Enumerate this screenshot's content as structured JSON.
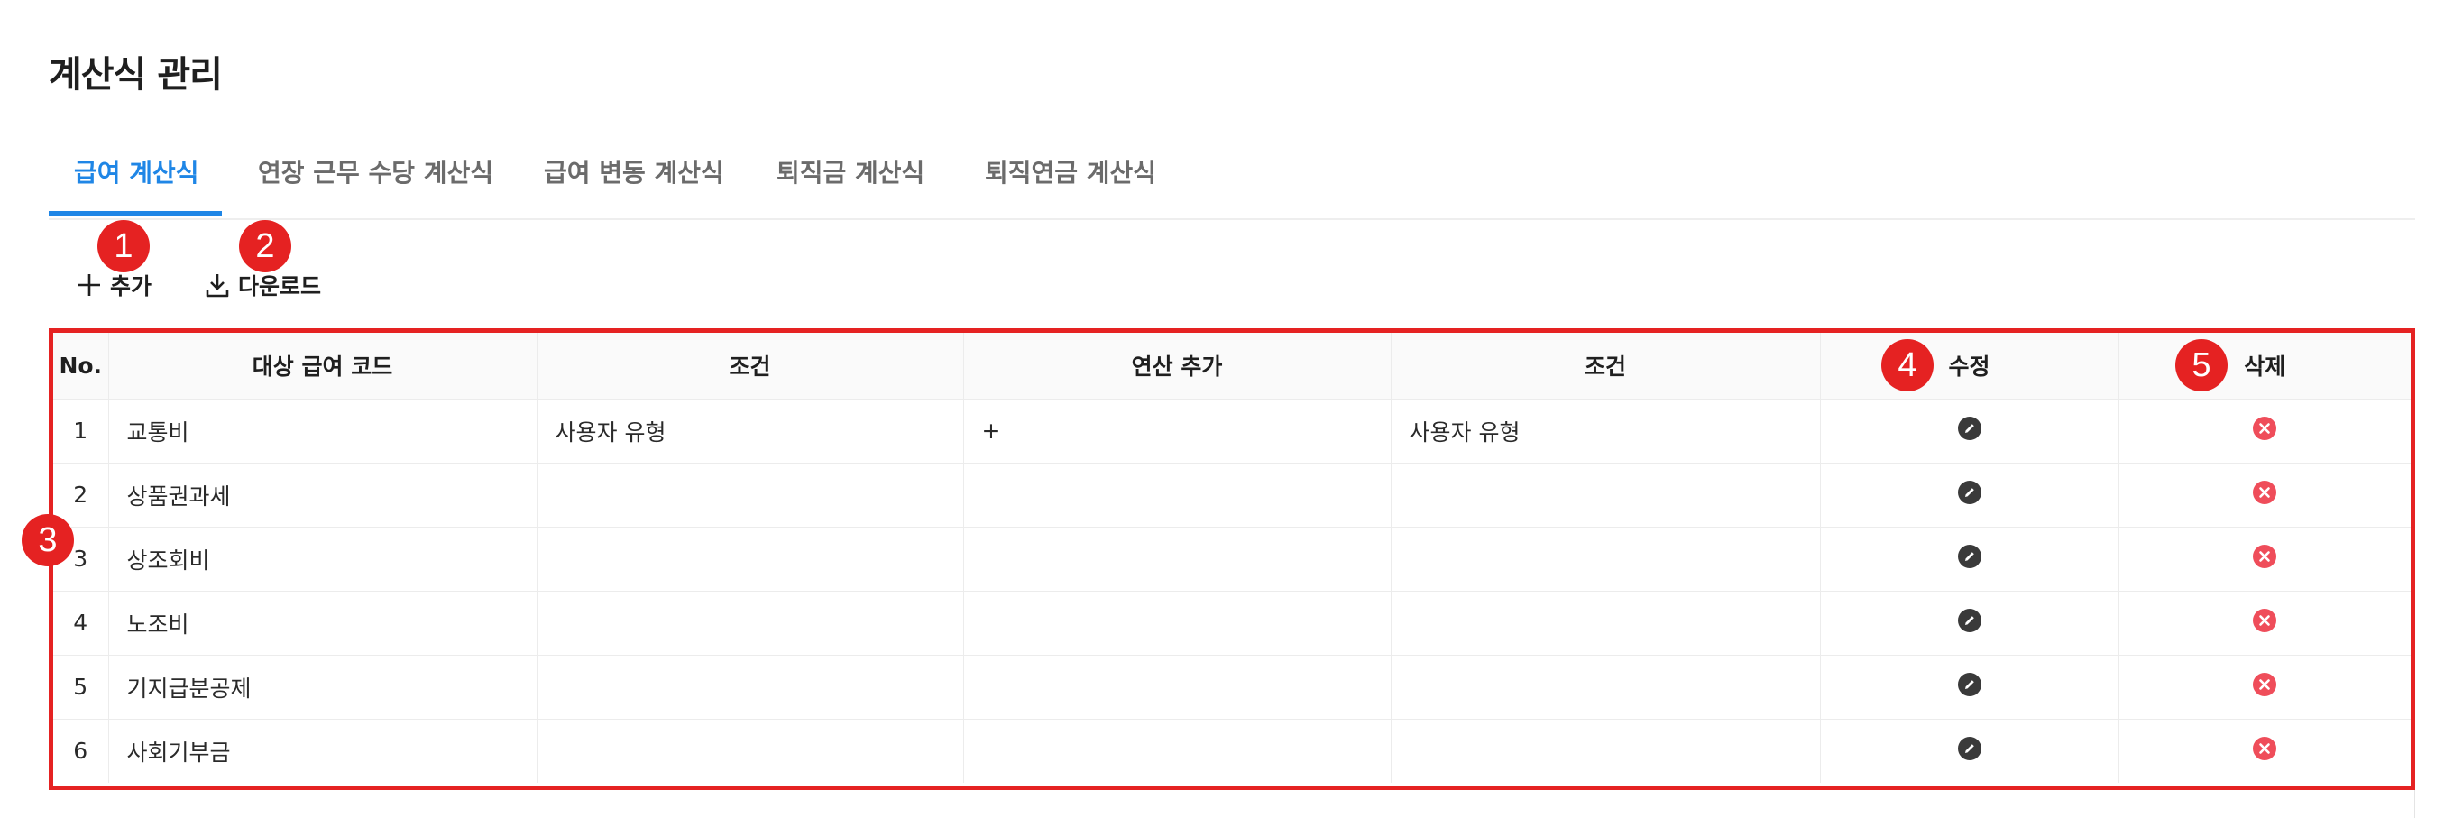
{
  "page": {
    "title": "계산식 관리"
  },
  "tabs": [
    {
      "label": "급여 계산식",
      "active": true
    },
    {
      "label": "연장 근무 수당 계산식",
      "active": false
    },
    {
      "label": "급여 변동 계산식",
      "active": false
    },
    {
      "label": "퇴직금 계산식",
      "active": false
    },
    {
      "label": "퇴직연금 계산식",
      "active": false
    }
  ],
  "toolbar": {
    "add_label": "추가",
    "add_icon": "plus-icon",
    "download_label": "다운로드",
    "download_icon": "download-icon"
  },
  "markers": [
    "1",
    "2",
    "3",
    "4",
    "5"
  ],
  "table": {
    "headers": [
      "No.",
      "대상 급여 코드",
      "조건",
      "연산 추가",
      "조건",
      "수정",
      "삭제"
    ],
    "edit_icon": "pencil-icon",
    "delete_icon": "close-circle-icon",
    "rows": [
      {
        "no": "1",
        "code": "교통비",
        "cond1": "사용자 유형",
        "op": "+",
        "cond2": "사용자 유형"
      },
      {
        "no": "2",
        "code": "상품권과세",
        "cond1": "",
        "op": "",
        "cond2": ""
      },
      {
        "no": "3",
        "code": "상조회비",
        "cond1": "",
        "op": "",
        "cond2": ""
      },
      {
        "no": "4",
        "code": "노조비",
        "cond1": "",
        "op": "",
        "cond2": ""
      },
      {
        "no": "5",
        "code": "기지급분공제",
        "cond1": "",
        "op": "",
        "cond2": ""
      },
      {
        "no": "6",
        "code": "사회기부금",
        "cond1": "",
        "op": "",
        "cond2": ""
      }
    ]
  },
  "colors": {
    "accent": "#1f86e6",
    "marker": "#e52222",
    "edit_icon": "#3a3a3a",
    "delete_icon": "#ef4d5a"
  }
}
